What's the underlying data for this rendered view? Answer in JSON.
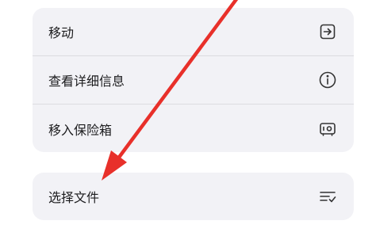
{
  "menu": {
    "items": [
      {
        "label": "移动",
        "icon": "move-to-icon"
      },
      {
        "label": "查看详细信息",
        "icon": "info-icon"
      },
      {
        "label": "移入保险箱",
        "icon": "safe-icon"
      }
    ]
  },
  "select_menu": {
    "items": [
      {
        "label": "选择文件",
        "icon": "checklist-icon"
      }
    ]
  },
  "colors": {
    "group_background": "#f2f2f6",
    "divider": "#dcdce0",
    "text": "#1c1c1e",
    "icon": "#333333",
    "annotation_arrow": "#e8302a"
  }
}
